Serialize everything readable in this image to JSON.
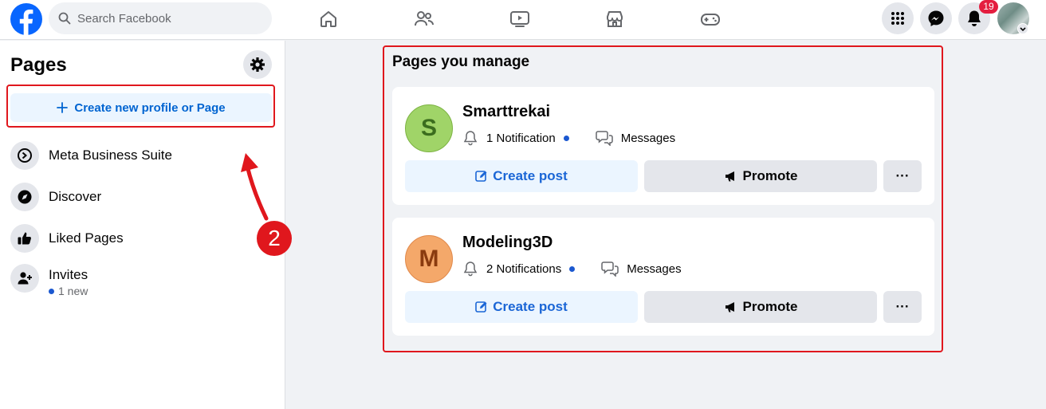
{
  "topbar": {
    "search_placeholder": "Search Facebook",
    "notification_count": "19"
  },
  "sidebar": {
    "title": "Pages",
    "create_label": "Create new profile or Page",
    "items": [
      {
        "label": "Meta Business Suite",
        "icon": "meta-business-suite-icon"
      },
      {
        "label": "Discover",
        "icon": "compass-icon"
      },
      {
        "label": "Liked Pages",
        "icon": "thumbs-up-icon"
      },
      {
        "label": "Invites",
        "icon": "add-person-icon",
        "sub": "1 new"
      }
    ]
  },
  "annotation": {
    "step": "2",
    "color": "#e0171d"
  },
  "main": {
    "title": "Pages you manage",
    "pages": [
      {
        "initial": "S",
        "name": "Smarttrekai",
        "avatar_color": "#8bc34a",
        "notifications": "1 Notification",
        "messages": "Messages",
        "create_post": "Create post",
        "promote": "Promote",
        "more": "···"
      },
      {
        "initial": "M",
        "name": "Modeling3D",
        "avatar_color": "#f0a060",
        "notifications": "2 Notifications",
        "messages": "Messages",
        "create_post": "Create post",
        "promote": "Promote",
        "more": "···"
      }
    ]
  },
  "colors": {
    "brand": "#0866ff",
    "link": "#0064d1",
    "highlight": "#e0171d"
  }
}
